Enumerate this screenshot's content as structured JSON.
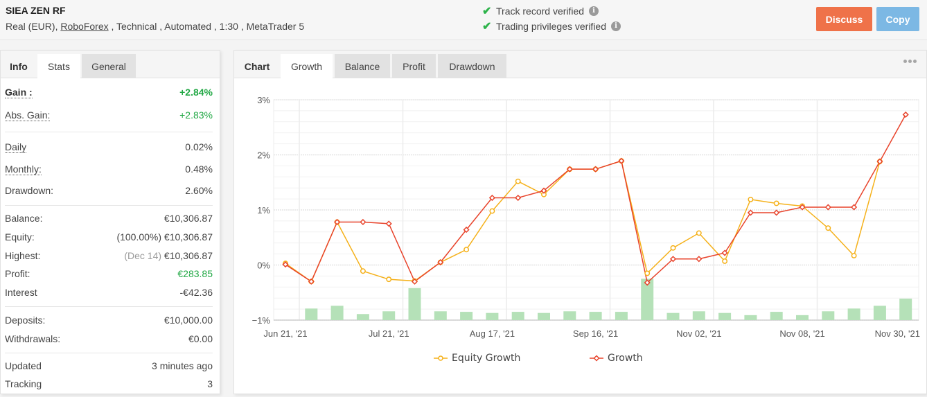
{
  "header": {
    "system_name": "SIEA ZEN RF",
    "meta_prefix": "Real (EUR), ",
    "broker": "RoboForex",
    "meta_suffix": " , Technical , Automated , 1:30 , MetaTrader 5",
    "verifications": [
      {
        "label": "Track record verified",
        "icon": "check-icon"
      },
      {
        "label": "Trading privileges verified",
        "icon": "check-icon"
      }
    ],
    "discuss_label": "Discuss",
    "copy_label": "Copy",
    "colors": {
      "discuss": "#ef7249",
      "copy": "#7cb8e4",
      "check": "#2db34a"
    }
  },
  "left_panel": {
    "tabs": [
      {
        "label": "Info",
        "state": "title"
      },
      {
        "label": "Stats",
        "state": "active"
      },
      {
        "label": "General",
        "state": "inactive"
      }
    ],
    "stats": {
      "gain": {
        "label": "Gain :",
        "value": "+2.84%"
      },
      "abs_gain": {
        "label": "Abs. Gain:",
        "value": "+2.83%"
      },
      "daily": {
        "label": "Daily",
        "value": "0.02%"
      },
      "monthly": {
        "label": "Monthly:",
        "value": "0.48%"
      },
      "drawdown": {
        "label": "Drawdown:",
        "value": "2.60%"
      },
      "balance": {
        "label": "Balance:",
        "value": "€10,306.87"
      },
      "equity": {
        "label": "Equity:",
        "note": "(100.00%)",
        "value": "€10,306.87"
      },
      "highest": {
        "label": "Highest:",
        "note": "(Dec 14)",
        "value": "€10,306.87"
      },
      "profit": {
        "label": "Profit:",
        "value": "€283.85"
      },
      "interest": {
        "label": "Interest",
        "value": "-€42.36"
      },
      "deposits": {
        "label": "Deposits:",
        "value": "€10,000.00"
      },
      "withdrawals": {
        "label": "Withdrawals:",
        "value": "€0.00"
      },
      "updated": {
        "label": "Updated",
        "value": "3 minutes ago"
      },
      "tracking": {
        "label": "Tracking",
        "value": "3"
      }
    },
    "positive_color": "#22a845"
  },
  "right_panel": {
    "tabs": [
      {
        "label": "Chart",
        "state": "title"
      },
      {
        "label": "Growth",
        "state": "active"
      },
      {
        "label": "Balance",
        "state": "inactive"
      },
      {
        "label": "Profit",
        "state": "inactive"
      },
      {
        "label": "Drawdown",
        "state": "inactive"
      }
    ],
    "more_icon": "more-options-icon"
  },
  "chart_data": {
    "type": "line",
    "title": "",
    "xlabel": "",
    "ylabel": "",
    "ylim": [
      -1,
      3
    ],
    "yticks": [
      "3%",
      "2%",
      "1%",
      "0%",
      "−1%"
    ],
    "ytick_values": [
      3,
      2,
      1,
      0,
      -1
    ],
    "x_count": 25,
    "x_tick_labels": [
      {
        "index": 0,
        "label": "Jun 21, '21"
      },
      {
        "index": 4,
        "label": "Jul 21, '21"
      },
      {
        "index": 8,
        "label": "Aug 17, '21"
      },
      {
        "index": 12,
        "label": "Sep 16, '21"
      },
      {
        "index": 16,
        "label": "Nov 02, '21"
      },
      {
        "index": 20,
        "label": "Nov 08, '21"
      },
      {
        "index": 24,
        "label": "Nov 30, '21"
      }
    ],
    "grid": true,
    "legend_position": "bottom",
    "series": [
      {
        "name": "Equity Growth",
        "color": "#f5b11a",
        "marker": "circle",
        "values": [
          0.03,
          -0.3,
          0.78,
          -0.11,
          -0.26,
          -0.29,
          0.05,
          0.28,
          0.98,
          1.52,
          1.28,
          1.74,
          1.74,
          1.89,
          -0.15,
          0.31,
          0.58,
          0.07,
          1.19,
          1.12,
          1.07,
          0.67,
          0.17,
          1.88,
          null
        ]
      },
      {
        "name": "Growth",
        "color": "#e8432b",
        "marker": "diamond",
        "values": [
          0.01,
          -0.3,
          0.78,
          0.78,
          0.75,
          -0.3,
          0.05,
          0.64,
          1.22,
          1.22,
          1.35,
          1.74,
          1.74,
          1.89,
          -0.32,
          0.11,
          0.11,
          0.22,
          0.95,
          0.95,
          1.05,
          1.05,
          1.05,
          1.88,
          2.73
        ]
      }
    ],
    "bars": {
      "name": "activity",
      "color": "#b5e1b8",
      "baseline": -1,
      "relative_heights": [
        null,
        0.21,
        0.26,
        0.11,
        0.16,
        0.58,
        0.16,
        0.15,
        0.13,
        0.15,
        0.13,
        0.16,
        0.15,
        0.15,
        0.75,
        0.13,
        0.16,
        0.13,
        0.09,
        0.15,
        0.09,
        0.16,
        0.21,
        0.26,
        0.39
      ]
    }
  }
}
